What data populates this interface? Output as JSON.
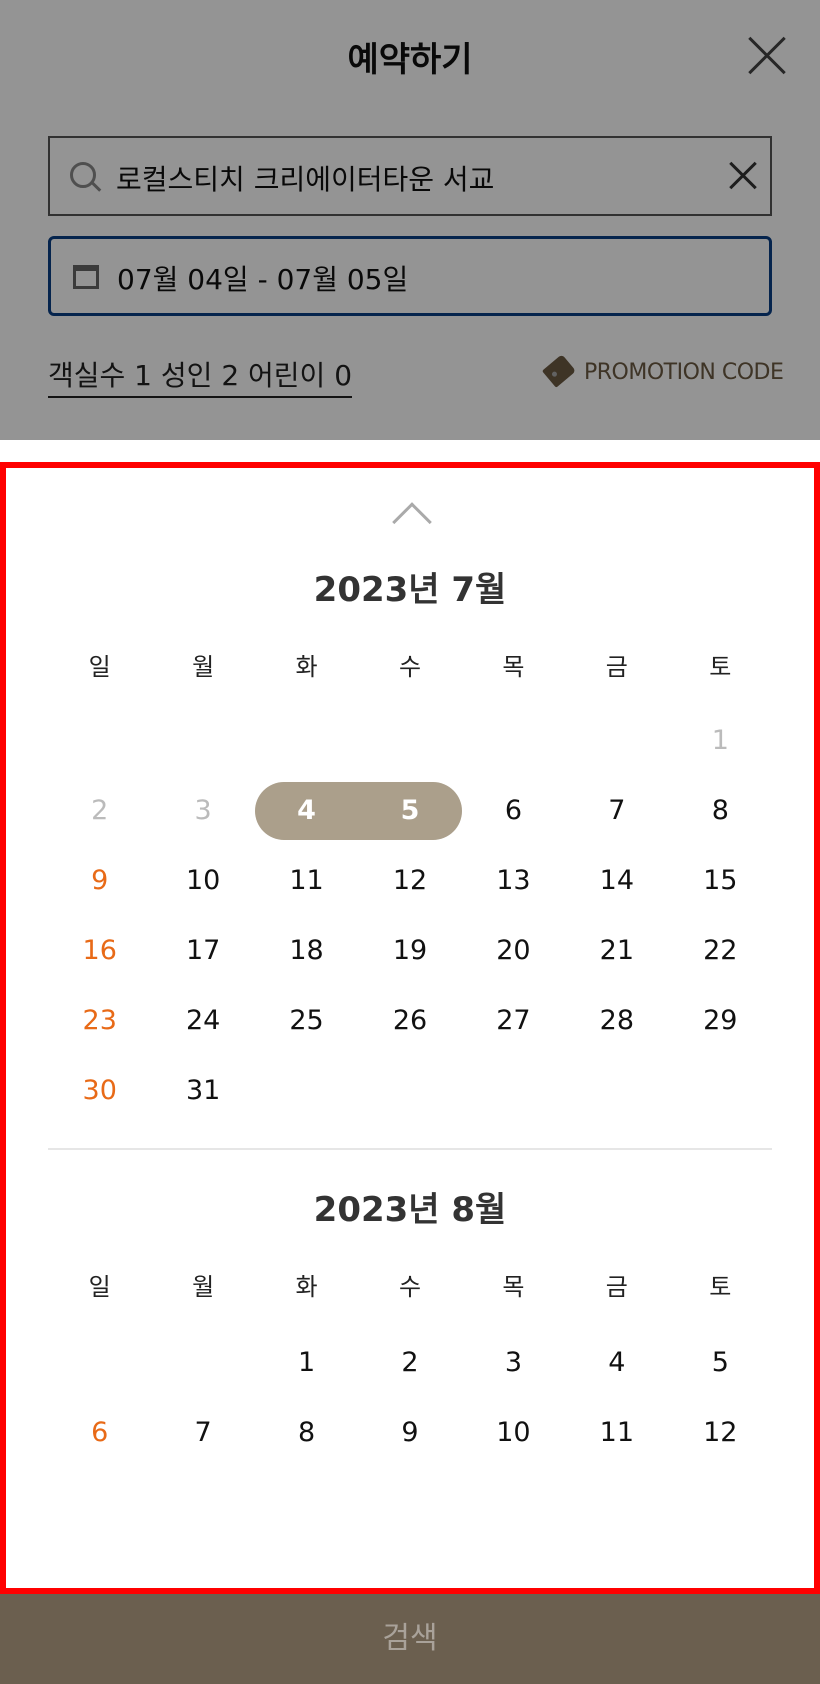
{
  "header": {
    "title": "예약하기",
    "search_value": "로컬스티치 크리에이터타운 서교",
    "date_range": "07월 04일 - 07월 05일",
    "guests": "객실수 1 성인 2 어린이 0",
    "promotion": "PROMOTION CODE"
  },
  "calendar": {
    "weekdays": [
      "일",
      "월",
      "화",
      "수",
      "목",
      "금",
      "토"
    ],
    "months": [
      {
        "title": "2023년  7월",
        "leading_blanks": 6,
        "days": [
          "1",
          "2",
          "3",
          "4",
          "5",
          "6",
          "7",
          "8",
          "9",
          "10",
          "11",
          "12",
          "13",
          "14",
          "15",
          "16",
          "17",
          "18",
          "19",
          "20",
          "21",
          "22",
          "23",
          "24",
          "25",
          "26",
          "27",
          "28",
          "29",
          "30",
          "31"
        ],
        "disabled_days": [
          "1",
          "2",
          "3"
        ],
        "selected_range": [
          "4",
          "5"
        ]
      },
      {
        "title": "2023년  8월",
        "leading_blanks": 2,
        "days": [
          "1",
          "2",
          "3",
          "4",
          "5",
          "6",
          "7",
          "8",
          "9",
          "10",
          "11",
          "12"
        ],
        "disabled_days": [],
        "selected_range": []
      }
    ]
  },
  "colors": {
    "accent_brown": "#6b5a43",
    "selection": "#ab9f8b",
    "sunday": "#e86a17",
    "date_border": "#0a3f86"
  },
  "footer": {
    "search_label": "검색"
  }
}
